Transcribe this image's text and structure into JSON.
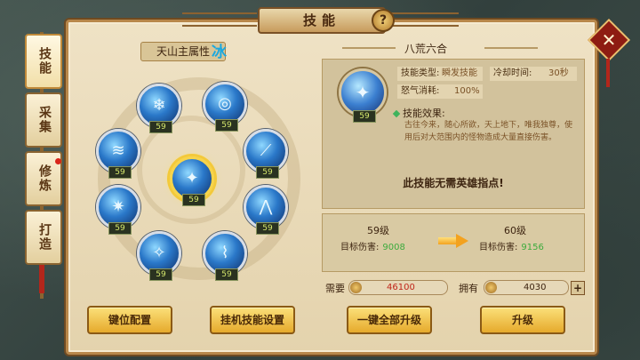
{
  "window": {
    "title": "技能",
    "help_glyph": "?",
    "close_glyph": "✕"
  },
  "side_tabs": [
    {
      "label": "技能",
      "active": true
    },
    {
      "label": "采集",
      "active": false
    },
    {
      "label": "修炼",
      "active": false,
      "badge": true
    },
    {
      "label": "打造",
      "active": false
    }
  ],
  "attribute": {
    "label": "天山主属性",
    "value": "冰"
  },
  "skills": [
    {
      "icon": "snowflake-icon",
      "glyph": "❄",
      "level": "59"
    },
    {
      "icon": "ice-vortex-icon",
      "glyph": "◎",
      "level": "59"
    },
    {
      "icon": "ice-wave-icon",
      "glyph": "≋",
      "level": "59"
    },
    {
      "icon": "ice-blade-icon",
      "glyph": "⟋",
      "level": "59"
    },
    {
      "icon": "ice-figure-icon",
      "glyph": "✦",
      "level": "59",
      "selected": true
    },
    {
      "icon": "ice-crystal-icon",
      "glyph": "✷",
      "level": "59"
    },
    {
      "icon": "ice-spikes-icon",
      "glyph": "⋀",
      "level": "59"
    },
    {
      "icon": "ice-shard-icon",
      "glyph": "✧",
      "level": "59"
    },
    {
      "icon": "ice-claw-icon",
      "glyph": "⌇",
      "level": "59"
    }
  ],
  "detail": {
    "name": "八荒六合",
    "icon": "ice-figure-icon",
    "glyph": "✦",
    "level": "59",
    "type_label": "技能类型:",
    "type_value": "瞬发技能",
    "cooldown_label": "冷却时间:",
    "cooldown_value": "30秒",
    "rage_label": "怒气消耗:",
    "rage_value": "100%",
    "effect_label": "技能效果:",
    "effect_text": "古往今来，随心所欲，天上地下，唯我独尊，使用后对大范围内的怪物造成大量直接伤害。",
    "hint": "此技能无需英雄指点!"
  },
  "compare": {
    "current_level": "59级",
    "next_level": "60级",
    "damage_label": "目标伤害:",
    "current_damage": "9008",
    "next_damage": "9156"
  },
  "resources": {
    "need_label": "需要",
    "need_value": "46100",
    "have_label": "拥有",
    "have_value": "4030",
    "plus_glyph": "+"
  },
  "buttons": {
    "key_config": "键位配置",
    "auto_skill": "挂机技能设置",
    "upgrade_all": "一键全部升级",
    "upgrade": "升级"
  },
  "colors": {
    "attribute_ice": "#1aa8e0",
    "damage_green": "#3dab3d",
    "gold_button": "#e6aa2c"
  }
}
